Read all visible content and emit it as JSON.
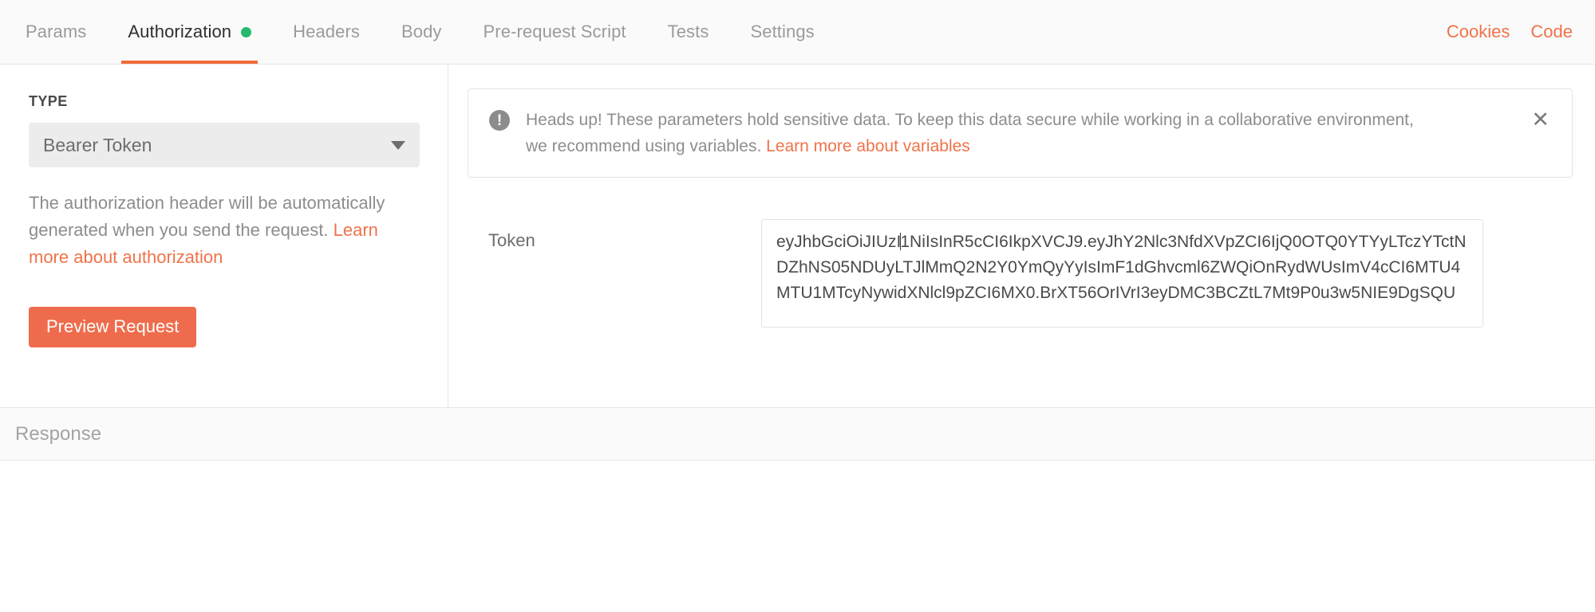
{
  "tabbar": {
    "tabs": [
      {
        "label": "Params",
        "active": false,
        "has_dot": false
      },
      {
        "label": "Authorization",
        "active": true,
        "has_dot": true
      },
      {
        "label": "Headers",
        "active": false,
        "has_dot": false
      },
      {
        "label": "Body",
        "active": false,
        "has_dot": false
      },
      {
        "label": "Pre-request Script",
        "active": false,
        "has_dot": false
      },
      {
        "label": "Tests",
        "active": false,
        "has_dot": false
      },
      {
        "label": "Settings",
        "active": false,
        "has_dot": false
      }
    ],
    "cookies_label": "Cookies",
    "code_label": "Code",
    "active_indicator_color": "#f26b3a",
    "dot_color": "#26b96b",
    "link_color": "#f0734a"
  },
  "auth_panel": {
    "type_label": "TYPE",
    "type_value": "Bearer Token",
    "help_text_before": "The authorization header will be automatically generated when you send the request. ",
    "help_link": "Learn more about authorization",
    "preview_button": "Preview Request",
    "preview_button_color": "#ee6c4d"
  },
  "alert": {
    "icon": "exclamation-circle-icon",
    "text_before": "Heads up! These parameters hold sensitive data. To keep this data secure while working in a collaborative environment, we recommend using variables. ",
    "link": "Learn more about variables",
    "close_label": "✕"
  },
  "token_field": {
    "label": "Token",
    "value_part1": "eyJhbGciOiJIUzI",
    "value_part2": "1NiIsInR5cCI6IkpXVCJ9.eyJhY2Nlc3NfdXVpZCI6IjQ0OTQ0YTYyLTczYTctNDZhNS05NDUyLTJlMmQ2N2Y0YmQyYyIsImF1dGhvcml6ZWQiOnRydWUsImV4cCI6MTU4MTU1MTcyNywidXNlcl9pZCI6MX0.BrXT56OrIVrI3eyDMC3BCZtL7Mt9P0u3w5NIE9DgSQU",
    "full_value": "eyJhbGciOiJIUzI1NiIsInR5cCI6IkpXVCJ9.eyJhY2Nlc3NfdXVpZCI6IjQ0OTQ0YTYyLTczYTctNDZhNS05NDUyLTJlMmQ2N2Y0YmQyYyIsImF1dGhvcml6ZWQiOnRydWUsImV4cCI6MTU4MTU1MTcyNywidXNlcl9pZCI6MX0.BrXT56OrIVrI3eyDMC3BCZtL7Mt9P0u3w5NIE9DgSQU"
  },
  "response": {
    "title": "Response"
  }
}
